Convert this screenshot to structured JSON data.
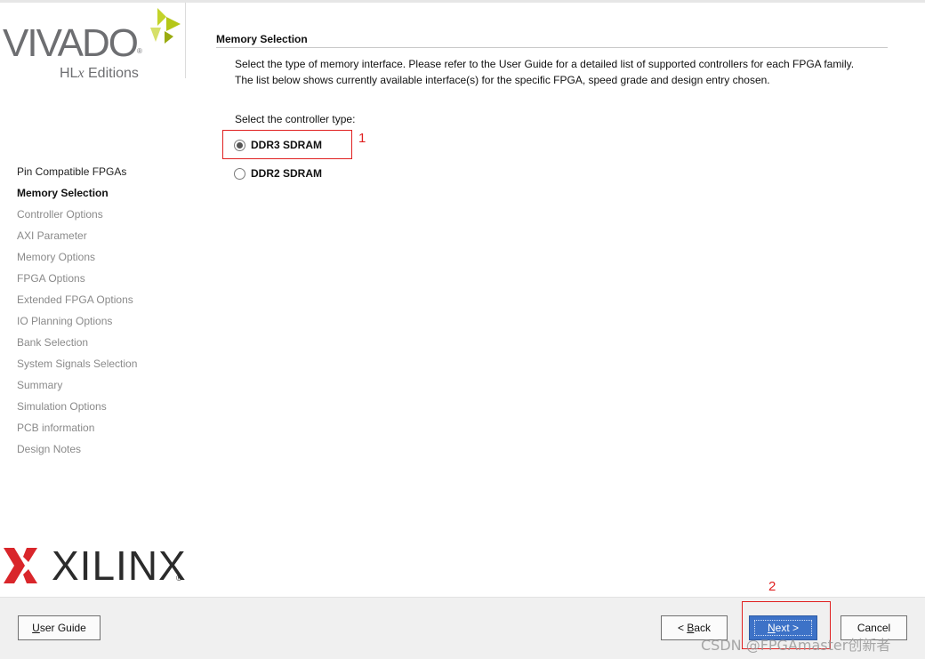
{
  "branding": {
    "vivado_word": "VIVADO",
    "vivado_sub_prefix": "HL",
    "vivado_sub_italic": "x",
    "vivado_sub_suffix": " Editions",
    "xilinx_word": "XILINX",
    "registered": "®",
    "accent_color": "#b5c718"
  },
  "sidebar": {
    "items": [
      {
        "label": "Pin Compatible FPGAs",
        "state": "done"
      },
      {
        "label": "Memory Selection",
        "state": "current"
      },
      {
        "label": "Controller Options",
        "state": "pending"
      },
      {
        "label": "AXI Parameter",
        "state": "pending"
      },
      {
        "label": "Memory Options",
        "state": "pending"
      },
      {
        "label": "FPGA Options",
        "state": "pending"
      },
      {
        "label": "Extended FPGA Options",
        "state": "pending"
      },
      {
        "label": "IO Planning Options",
        "state": "pending"
      },
      {
        "label": "Bank Selection",
        "state": "pending"
      },
      {
        "label": "System Signals Selection",
        "state": "pending"
      },
      {
        "label": "Summary",
        "state": "pending"
      },
      {
        "label": "Simulation Options",
        "state": "pending"
      },
      {
        "label": "PCB information",
        "state": "pending"
      },
      {
        "label": "Design Notes",
        "state": "pending"
      }
    ]
  },
  "main": {
    "section_title": "Memory Selection",
    "description_line1": "Select the type of memory interface. Please refer to the User Guide for a detailed list of supported controllers for each FPGA family.",
    "description_line2": "The list below shows currently available interface(s) for the specific FPGA, speed grade and design entry chosen.",
    "controller_label": "Select the controller type:",
    "options": [
      {
        "label": "DDR3 SDRAM",
        "selected": true
      },
      {
        "label": "DDR2 SDRAM",
        "selected": false
      }
    ]
  },
  "annotations": {
    "marker1": "1",
    "marker2": "2",
    "color": "#e02020"
  },
  "footer": {
    "user_guide_pre": "",
    "user_guide_u": "U",
    "user_guide_post": "ser Guide",
    "back_pre": "< ",
    "back_u": "B",
    "back_post": "ack",
    "next_pre": "",
    "next_u": "N",
    "next_post": "ext >",
    "cancel_label": "Cancel",
    "next_color": "#3d72c7"
  },
  "watermark": "CSDN @FPGAmaster创新者"
}
